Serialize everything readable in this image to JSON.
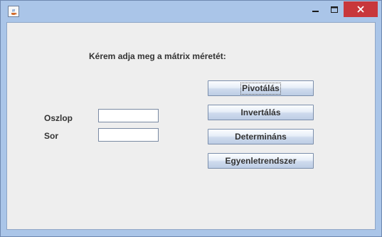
{
  "window": {
    "title": "",
    "app_icon": "java-cup-icon",
    "controls": {
      "minimize_icon": "minimize-icon",
      "maximize_icon": "maximize-icon",
      "close_icon": "close-icon",
      "close_color": "#c8373b"
    }
  },
  "form": {
    "prompt": "Kérem adja meg a mátrix méretét:",
    "fields": {
      "oszlop_label": "Oszlop",
      "oszlop_value": "",
      "sor_label": "Sor",
      "sor_value": ""
    },
    "buttons": {
      "pivot": "Pivotálás",
      "invert": "Invertálás",
      "determinant": "Determináns",
      "equation_system": "Egyenletrendszer"
    }
  },
  "theme": {
    "titlebar_color": "#aac5e8",
    "client_background": "#eeeeee"
  }
}
